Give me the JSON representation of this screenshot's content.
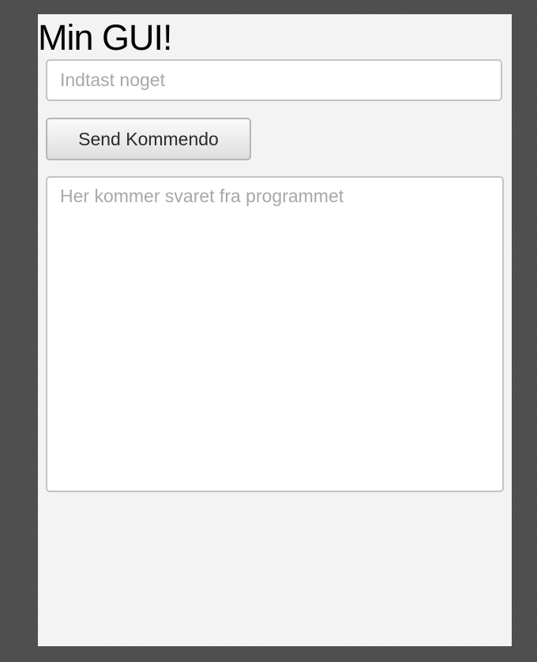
{
  "app": {
    "title": "Min GUI!"
  },
  "input": {
    "value": "",
    "placeholder": "Indtast noget"
  },
  "send_button": {
    "label": "Send Kommendo"
  },
  "output": {
    "value": "",
    "placeholder": "Her kommer svaret fra programmet"
  }
}
